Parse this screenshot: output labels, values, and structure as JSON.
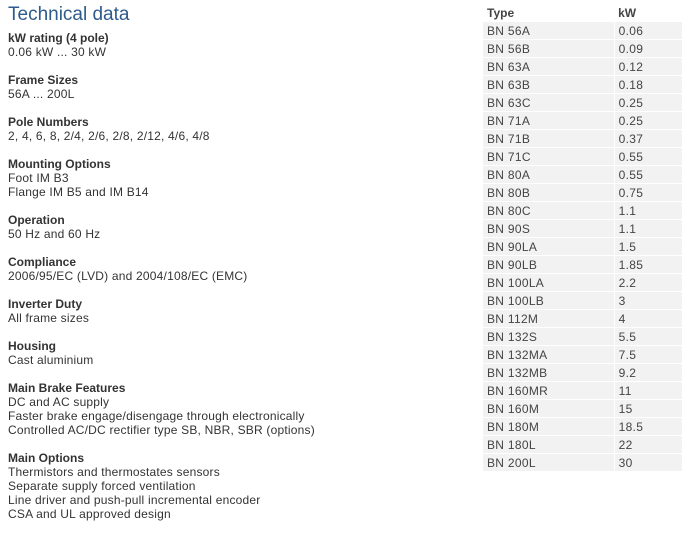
{
  "title": "Technical data",
  "sections": [
    {
      "heading": "kW rating (4 pole)",
      "lines": [
        "0.06 kW ... 30 kW"
      ]
    },
    {
      "heading": "Frame Sizes",
      "lines": [
        "56A ... 200L"
      ]
    },
    {
      "heading": "Pole Numbers",
      "lines": [
        "2, 4, 6, 8, 2/4, 2/6, 2/8, 2/12, 4/6, 4/8"
      ]
    },
    {
      "heading": "Mounting Options",
      "lines": [
        "Foot IM B3",
        "Flange IM B5 and IM B14"
      ]
    },
    {
      "heading": "Operation",
      "lines": [
        "50 Hz and 60 Hz"
      ]
    },
    {
      "heading": "Compliance",
      "lines": [
        "2006/95/EC (LVD) and 2004/108/EC (EMC)"
      ]
    },
    {
      "heading": "Inverter Duty",
      "lines": [
        "All frame sizes"
      ]
    },
    {
      "heading": "Housing",
      "lines": [
        "Cast aluminium"
      ]
    },
    {
      "heading": "Main Brake Features",
      "lines": [
        "DC and AC supply",
        "Faster brake engage/disengage through electronically",
        "Controlled AC/DC rectifier type SB, NBR, SBR (options)"
      ]
    },
    {
      "heading": "Main Options",
      "lines": [
        "Thermistors and thermostates sensors",
        "Separate supply forced ventilation",
        "Line driver and push-pull incremental encoder",
        "CSA and UL approved design"
      ]
    }
  ],
  "table": {
    "headers": [
      "Type",
      "kW"
    ],
    "rows": [
      [
        "BN 56A",
        "0.06"
      ],
      [
        "BN 56B",
        "0.09"
      ],
      [
        "BN 63A",
        "0.12"
      ],
      [
        "BN 63B",
        "0.18"
      ],
      [
        "BN 63C",
        "0.25"
      ],
      [
        "BN 71A",
        "0.25"
      ],
      [
        "BN 71B",
        "0.37"
      ],
      [
        "BN 71C",
        "0.55"
      ],
      [
        "BN 80A",
        "0.55"
      ],
      [
        "BN 80B",
        "0.75"
      ],
      [
        "BN 80C",
        "1.1"
      ],
      [
        "BN 90S",
        "1.1"
      ],
      [
        "BN 90LA",
        "1.5"
      ],
      [
        "BN 90LB",
        "1.85"
      ],
      [
        "BN 100LA",
        "2.2"
      ],
      [
        "BN 100LB",
        "3"
      ],
      [
        "BN 112M",
        "4"
      ],
      [
        "BN 132S",
        "5.5"
      ],
      [
        "BN 132MA",
        "7.5"
      ],
      [
        "BN 132MB",
        "9.2"
      ],
      [
        "BN 160MR",
        "11"
      ],
      [
        "BN 160M",
        "15"
      ],
      [
        "BN 180M",
        "18.5"
      ],
      [
        "BN 180L",
        "22"
      ],
      [
        "BN 200L",
        "30"
      ]
    ]
  }
}
